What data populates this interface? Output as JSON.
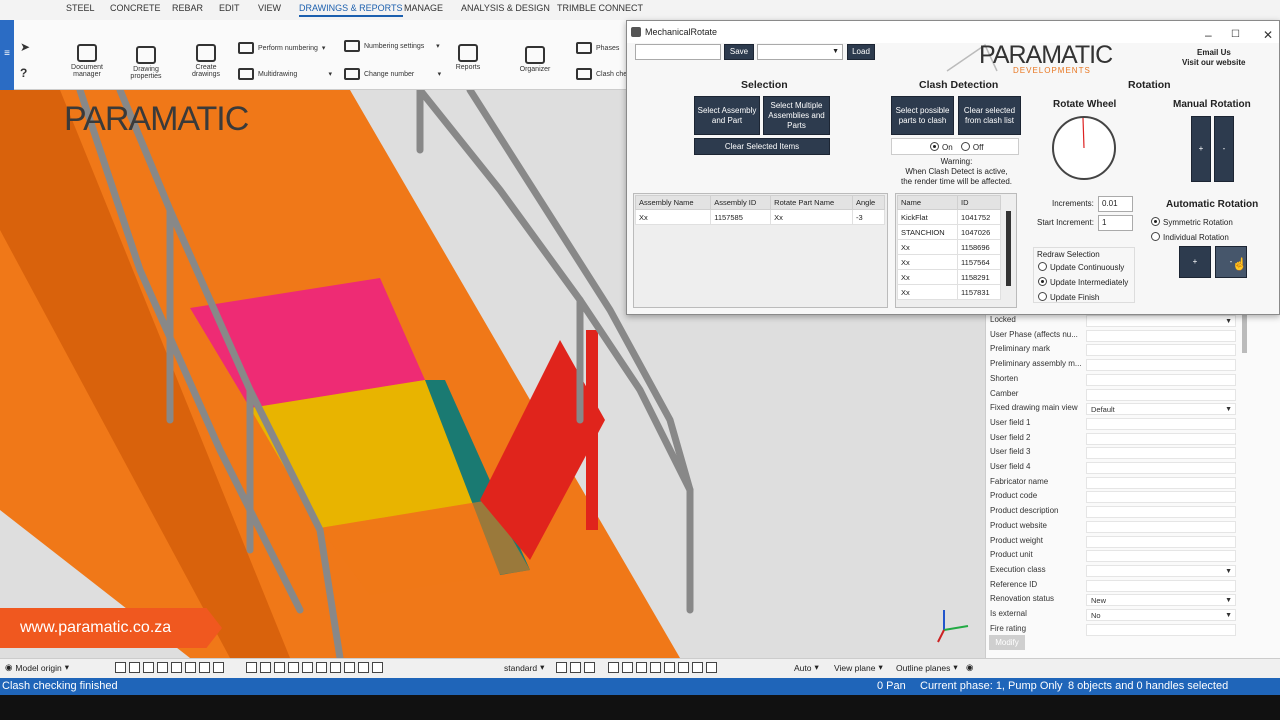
{
  "ribbon": {
    "tabs": [
      "STEEL",
      "CONCRETE",
      "REBAR",
      "EDIT",
      "VIEW",
      "DRAWINGS & REPORTS",
      "MANAGE",
      "ANALYSIS & DESIGN",
      "TRIMBLE CONNECT"
    ],
    "active_tab": "DRAWINGS & REPORTS",
    "buttons": {
      "document_manager": "Document manager",
      "drawing_properties": "Drawing properties",
      "create_drawings": "Create drawings",
      "perform_numbering": "Perform numbering",
      "multidrawing": "Multidrawing",
      "numbering_settings": "Numbering settings",
      "change_number": "Change number",
      "reports": "Reports",
      "organizer": "Organizer",
      "phases": "Phases",
      "clash_check": "Clash check"
    }
  },
  "viewport": {
    "watermark": "PARAMATIC",
    "website": "www.paramatic.co.za"
  },
  "dialog": {
    "title": "MechanicalRotate",
    "save": "Save",
    "load": "Load",
    "logo": "PARAMATIC",
    "logo_sub": "DEVELOPMENTS",
    "email": "Email Us",
    "website": "Visit our website",
    "selection": {
      "heading": "Selection",
      "select_assembly": "Select Assembly and Part",
      "select_multiple": "Select Multiple Assemblies and Parts",
      "clear": "Clear Selected Items"
    },
    "clash": {
      "heading": "Clash Detection",
      "select_possible": "Select possible parts to clash",
      "clear_selected": "Clear selected from clash list",
      "on": "On",
      "off": "Off",
      "warning_title": "Warning:",
      "warning_line1": "When Clash Detect is active,",
      "warning_line2": "the render time will be affected."
    },
    "rotation": {
      "heading": "Rotation",
      "wheel": "Rotate Wheel",
      "manual": "Manual Rotation",
      "plus": "+",
      "minus": "-",
      "increments_label": "Increments:",
      "increments_value": "0.01",
      "start_label": "Start Increment:",
      "start_value": "1",
      "automatic": "Automatic Rotation",
      "symmetric": "Symmetric Rotation",
      "individual": "Individual Rotation"
    },
    "assembly_table": {
      "columns": [
        "Assembly Name",
        "Assembly ID",
        "Rotate Part Name",
        "Angle"
      ],
      "rows": [
        [
          "Xx",
          "1157585",
          "Xx",
          "-3"
        ]
      ]
    },
    "clash_table": {
      "columns": [
        "Name",
        "ID"
      ],
      "rows": [
        [
          "KickFlat",
          "1041752"
        ],
        [
          "STANCHION",
          "1047026"
        ],
        [
          "Xx",
          "1158696"
        ],
        [
          "Xx",
          "1157564"
        ],
        [
          "Xx",
          "1158291"
        ],
        [
          "Xx",
          "1157831"
        ]
      ]
    },
    "redraw": {
      "title": "Redraw Selection",
      "options": [
        "Update Continuously",
        "Update Intermediately",
        "Update Finish"
      ],
      "selected": "Update Intermediately"
    }
  },
  "properties": [
    {
      "label": "Locked",
      "value": "",
      "dropdown": true
    },
    {
      "label": "User Phase   (affects nu...",
      "value": ""
    },
    {
      "label": "Preliminary mark",
      "value": ""
    },
    {
      "label": "Preliminary assembly m...",
      "value": ""
    },
    {
      "label": "Shorten",
      "value": ""
    },
    {
      "label": "Camber",
      "value": ""
    },
    {
      "label": "Fixed drawing main view",
      "value": "Default",
      "dropdown": true
    },
    {
      "label": "User field 1",
      "value": ""
    },
    {
      "label": "User field 2",
      "value": ""
    },
    {
      "label": "User field 3",
      "value": ""
    },
    {
      "label": "User field 4",
      "value": ""
    },
    {
      "label": "Fabricator name",
      "value": ""
    },
    {
      "label": "Product code",
      "value": ""
    },
    {
      "label": "Product description",
      "value": ""
    },
    {
      "label": "Product website",
      "value": ""
    },
    {
      "label": "Product weight",
      "value": ""
    },
    {
      "label": "Product unit",
      "value": ""
    },
    {
      "label": "Execution class",
      "value": "",
      "dropdown": true
    },
    {
      "label": "Reference ID",
      "value": ""
    },
    {
      "label": "Renovation status",
      "value": "New",
      "dropdown": true
    },
    {
      "label": "Is external",
      "value": "No",
      "dropdown": true
    },
    {
      "label": "Fire rating",
      "value": ""
    }
  ],
  "modify_button": "Modify",
  "bottom_toolbar": {
    "model_origin": "Model origin",
    "standard": "standard",
    "auto": "Auto",
    "view_plane": "View plane",
    "outline_planes": "Outline planes"
  },
  "status": {
    "message": "Clash checking finished",
    "pan": "0  Pan",
    "phase": "Current phase: 1, Pump Only",
    "selection": "8 objects and 0 handles selected"
  },
  "colors": {
    "accent": "#1f65b9",
    "dialog_button": "#2d3b4e",
    "website_banner": "#f0581f",
    "orange_model": "#f07818"
  }
}
